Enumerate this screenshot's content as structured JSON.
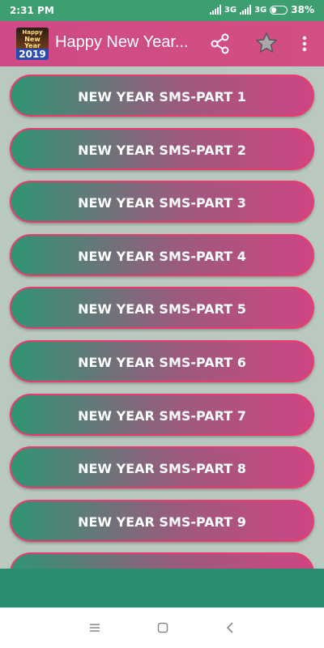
{
  "status_bar": {
    "time": "2:31 PM",
    "net1": "3G",
    "net2": "3G",
    "battery": "38%",
    "battery_level": 0.38
  },
  "app_bar": {
    "logo_line1": "Happy",
    "logo_line2": "New Year",
    "logo_year": "2019",
    "title": "Happy New Year...",
    "icons": [
      "share-icon",
      "star-icon",
      "overflow-menu-icon"
    ]
  },
  "list": {
    "items": [
      "NEW YEAR SMS-PART 1",
      "NEW YEAR SMS-PART 2",
      "NEW YEAR SMS-PART 3",
      "NEW YEAR SMS-PART 4",
      "NEW YEAR SMS-PART 5",
      "NEW YEAR SMS-PART 6",
      "NEW YEAR SMS-PART 7",
      "NEW YEAR SMS-PART 8",
      "NEW YEAR SMS-PART 9",
      ""
    ]
  },
  "colors": {
    "status_bar": "#3d9f6f",
    "app_bar": "#cf4a86",
    "item_border": "#e93c6d",
    "item_gradient_start": "#2f9574",
    "item_gradient_end": "#cf4583",
    "background": "#b9c9c0",
    "bottom_banner": "#2a8d6f"
  },
  "nav_bar": {
    "icons": [
      "menu-icon",
      "home-icon",
      "back-icon"
    ]
  }
}
